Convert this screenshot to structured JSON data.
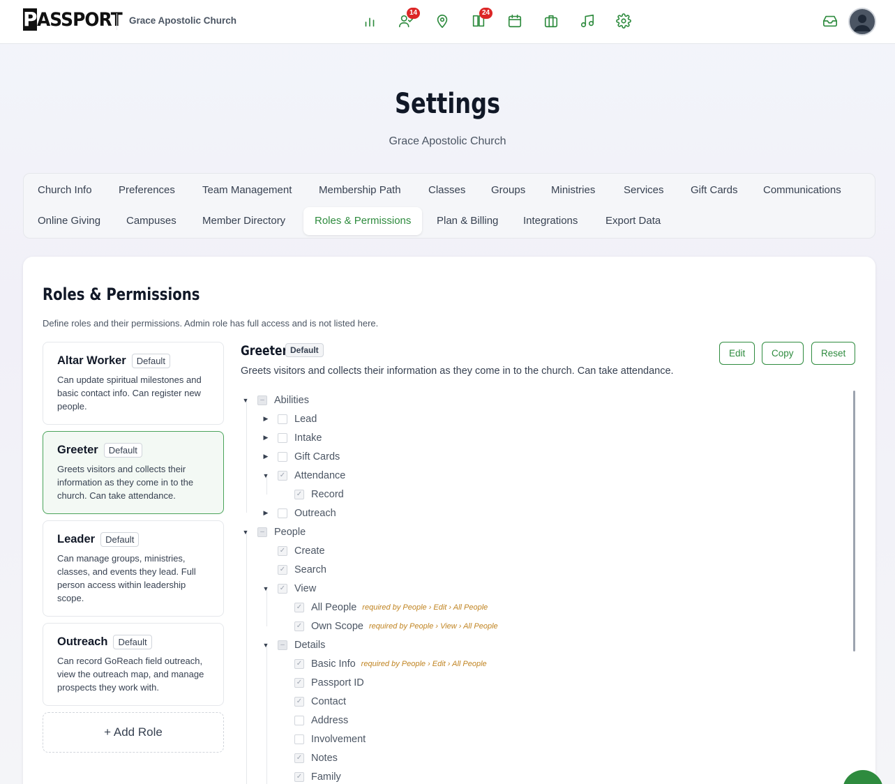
{
  "header": {
    "logo": "PASSPORT",
    "church_name": "Grace Apostolic Church",
    "nav": [
      {
        "icon": "bar-chart-icon",
        "badge": ""
      },
      {
        "icon": "people-icon",
        "badge": "14"
      },
      {
        "icon": "map-pin-icon",
        "badge": ""
      },
      {
        "icon": "book-icon",
        "badge": "24"
      },
      {
        "icon": "calendar-icon",
        "badge": ""
      },
      {
        "icon": "briefcase-icon",
        "badge": ""
      },
      {
        "icon": "music-icon",
        "badge": ""
      },
      {
        "icon": "gear-icon",
        "badge": ""
      }
    ],
    "inbox_icon": "inbox-icon",
    "avatar_icon": "user-avatar-icon"
  },
  "page": {
    "title": "Settings",
    "subtitle": "Grace Apostolic Church"
  },
  "tabs": {
    "row1": [
      "Church Info",
      "Preferences",
      "Team Management",
      "Membership Path",
      "Classes",
      "Groups",
      "Ministries",
      "Services",
      "Gift Cards",
      "Communications"
    ],
    "row2": [
      "Online Giving",
      "Campuses",
      "Member Directory",
      "Roles & Permissions",
      "Plan & Billing",
      "Integrations",
      "Export Data"
    ],
    "active": "Roles & Permissions"
  },
  "roles_section": {
    "title": "Roles & Permissions",
    "description": "Define roles and their permissions. Admin role has full access and is not listed here.",
    "roles": [
      {
        "name": "Altar Worker",
        "badge": "Default",
        "description": "Can update spiritual milestones and basic contact info. Can register new people."
      },
      {
        "name": "Greeter",
        "badge": "Default",
        "description": "Greets visitors and collects their information as they come in to the church. Can take attendance."
      },
      {
        "name": "Leader",
        "badge": "Default",
        "description": "Can manage groups, ministries, classes, and events they lead. Full person access within leadership scope."
      },
      {
        "name": "Outreach",
        "badge": "Default",
        "description": "Can record GoReach field outreach, view the outreach map, and manage prospects they work with."
      }
    ],
    "add_role_label": "+ Add Role"
  },
  "detail": {
    "name": "Greeter",
    "badge": "Default",
    "description": "Greets visitors and collects their information as they come in to the church. Can take attendance.",
    "buttons": {
      "edit": "Edit",
      "copy": "Copy",
      "reset": "Reset"
    },
    "tree": [
      {
        "label": "Abilities",
        "level": 0,
        "caret": "down",
        "state": "indeterminate",
        "req": ""
      },
      {
        "label": "Lead",
        "level": 1,
        "caret": "right",
        "state": "unchecked",
        "req": ""
      },
      {
        "label": "Intake",
        "level": 1,
        "caret": "right",
        "state": "unchecked",
        "req": ""
      },
      {
        "label": "Gift Cards",
        "level": 1,
        "caret": "right",
        "state": "unchecked",
        "req": ""
      },
      {
        "label": "Attendance",
        "level": 1,
        "caret": "down",
        "state": "checked",
        "req": ""
      },
      {
        "label": "Record",
        "level": 2,
        "caret": "",
        "state": "checked",
        "req": ""
      },
      {
        "label": "Outreach",
        "level": 1,
        "caret": "right",
        "state": "unchecked",
        "req": ""
      },
      {
        "label": "People",
        "level": 0,
        "caret": "down",
        "state": "indeterminate",
        "req": ""
      },
      {
        "label": "Create",
        "level": 1,
        "caret": "",
        "state": "checked",
        "req": ""
      },
      {
        "label": "Search",
        "level": 1,
        "caret": "",
        "state": "checked",
        "req": ""
      },
      {
        "label": "View",
        "level": 1,
        "caret": "down",
        "state": "checked",
        "req": ""
      },
      {
        "label": "All People",
        "level": 2,
        "caret": "",
        "state": "checked",
        "req": "required by People › Edit › All People"
      },
      {
        "label": "Own Scope",
        "level": 2,
        "caret": "",
        "state": "checked",
        "req": "required by People › View › All People"
      },
      {
        "label": "Details",
        "level": 1,
        "caret": "down",
        "state": "indeterminate",
        "req": ""
      },
      {
        "label": "Basic Info",
        "level": 2,
        "caret": "",
        "state": "checked",
        "req": "required by People › Edit › All People"
      },
      {
        "label": "Passport ID",
        "level": 2,
        "caret": "",
        "state": "checked",
        "req": ""
      },
      {
        "label": "Contact",
        "level": 2,
        "caret": "",
        "state": "checked",
        "req": ""
      },
      {
        "label": "Address",
        "level": 2,
        "caret": "",
        "state": "unchecked",
        "req": ""
      },
      {
        "label": "Involvement",
        "level": 2,
        "caret": "",
        "state": "unchecked",
        "req": ""
      },
      {
        "label": "Notes",
        "level": 2,
        "caret": "",
        "state": "checked",
        "req": ""
      },
      {
        "label": "Family",
        "level": 2,
        "caret": "",
        "state": "checked",
        "req": ""
      }
    ]
  },
  "colors": {
    "accent": "#2e8b3e",
    "badge_red": "#dc2626",
    "required_text": "#c08422"
  }
}
